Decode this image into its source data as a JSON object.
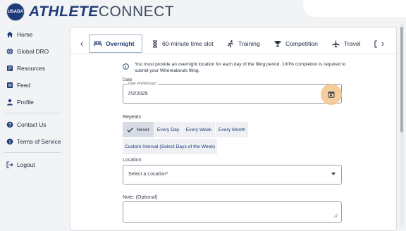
{
  "app": {
    "badge_text": "USADA",
    "logo_bold": "ATHLETE",
    "logo_regular": "CONNECT"
  },
  "sidebar": {
    "items": [
      {
        "label": "Home",
        "icon": "home-icon"
      },
      {
        "label": "Global DRO",
        "icon": "globe-icon"
      },
      {
        "label": "Resources",
        "icon": "book-icon"
      },
      {
        "label": "Feed",
        "icon": "feed-icon"
      },
      {
        "label": "Profile",
        "icon": "person-icon"
      },
      {
        "label": "Contact Us",
        "icon": "help-icon"
      },
      {
        "label": "Terms of Service",
        "icon": "info-icon"
      },
      {
        "label": "Logout",
        "icon": "logout-icon"
      }
    ]
  },
  "tabs": {
    "items": [
      {
        "label": "Overnight",
        "icon": "bed-icon",
        "active": true
      },
      {
        "label": "60-minute time slot",
        "icon": "hourglass-icon"
      },
      {
        "label": "Training",
        "icon": "running-icon"
      },
      {
        "label": "Competition",
        "icon": "trophy-icon"
      },
      {
        "label": "Travel",
        "icon": "airplane-icon"
      }
    ]
  },
  "form": {
    "info_text": "You must provide an overnight location for each day of the filing period. 100% completion is required to submit your Whereabouts filing.",
    "date_label": "Date",
    "date_placeholder": "Date mm/dd/yyyy*",
    "date_value": "7/2/2025",
    "repeats_label": "Repeats",
    "repeat_options": [
      "Never",
      "Every Day",
      "Every Week",
      "Every Month",
      "Custom Interval (Select Days of the Week)"
    ],
    "repeat_selected": "Never",
    "location_label": "Location",
    "location_placeholder": "Select a Location*",
    "note_label": "Note: (Optional)"
  },
  "colors": {
    "brand": "#1d3b77",
    "highlight": "#f3c48c"
  }
}
